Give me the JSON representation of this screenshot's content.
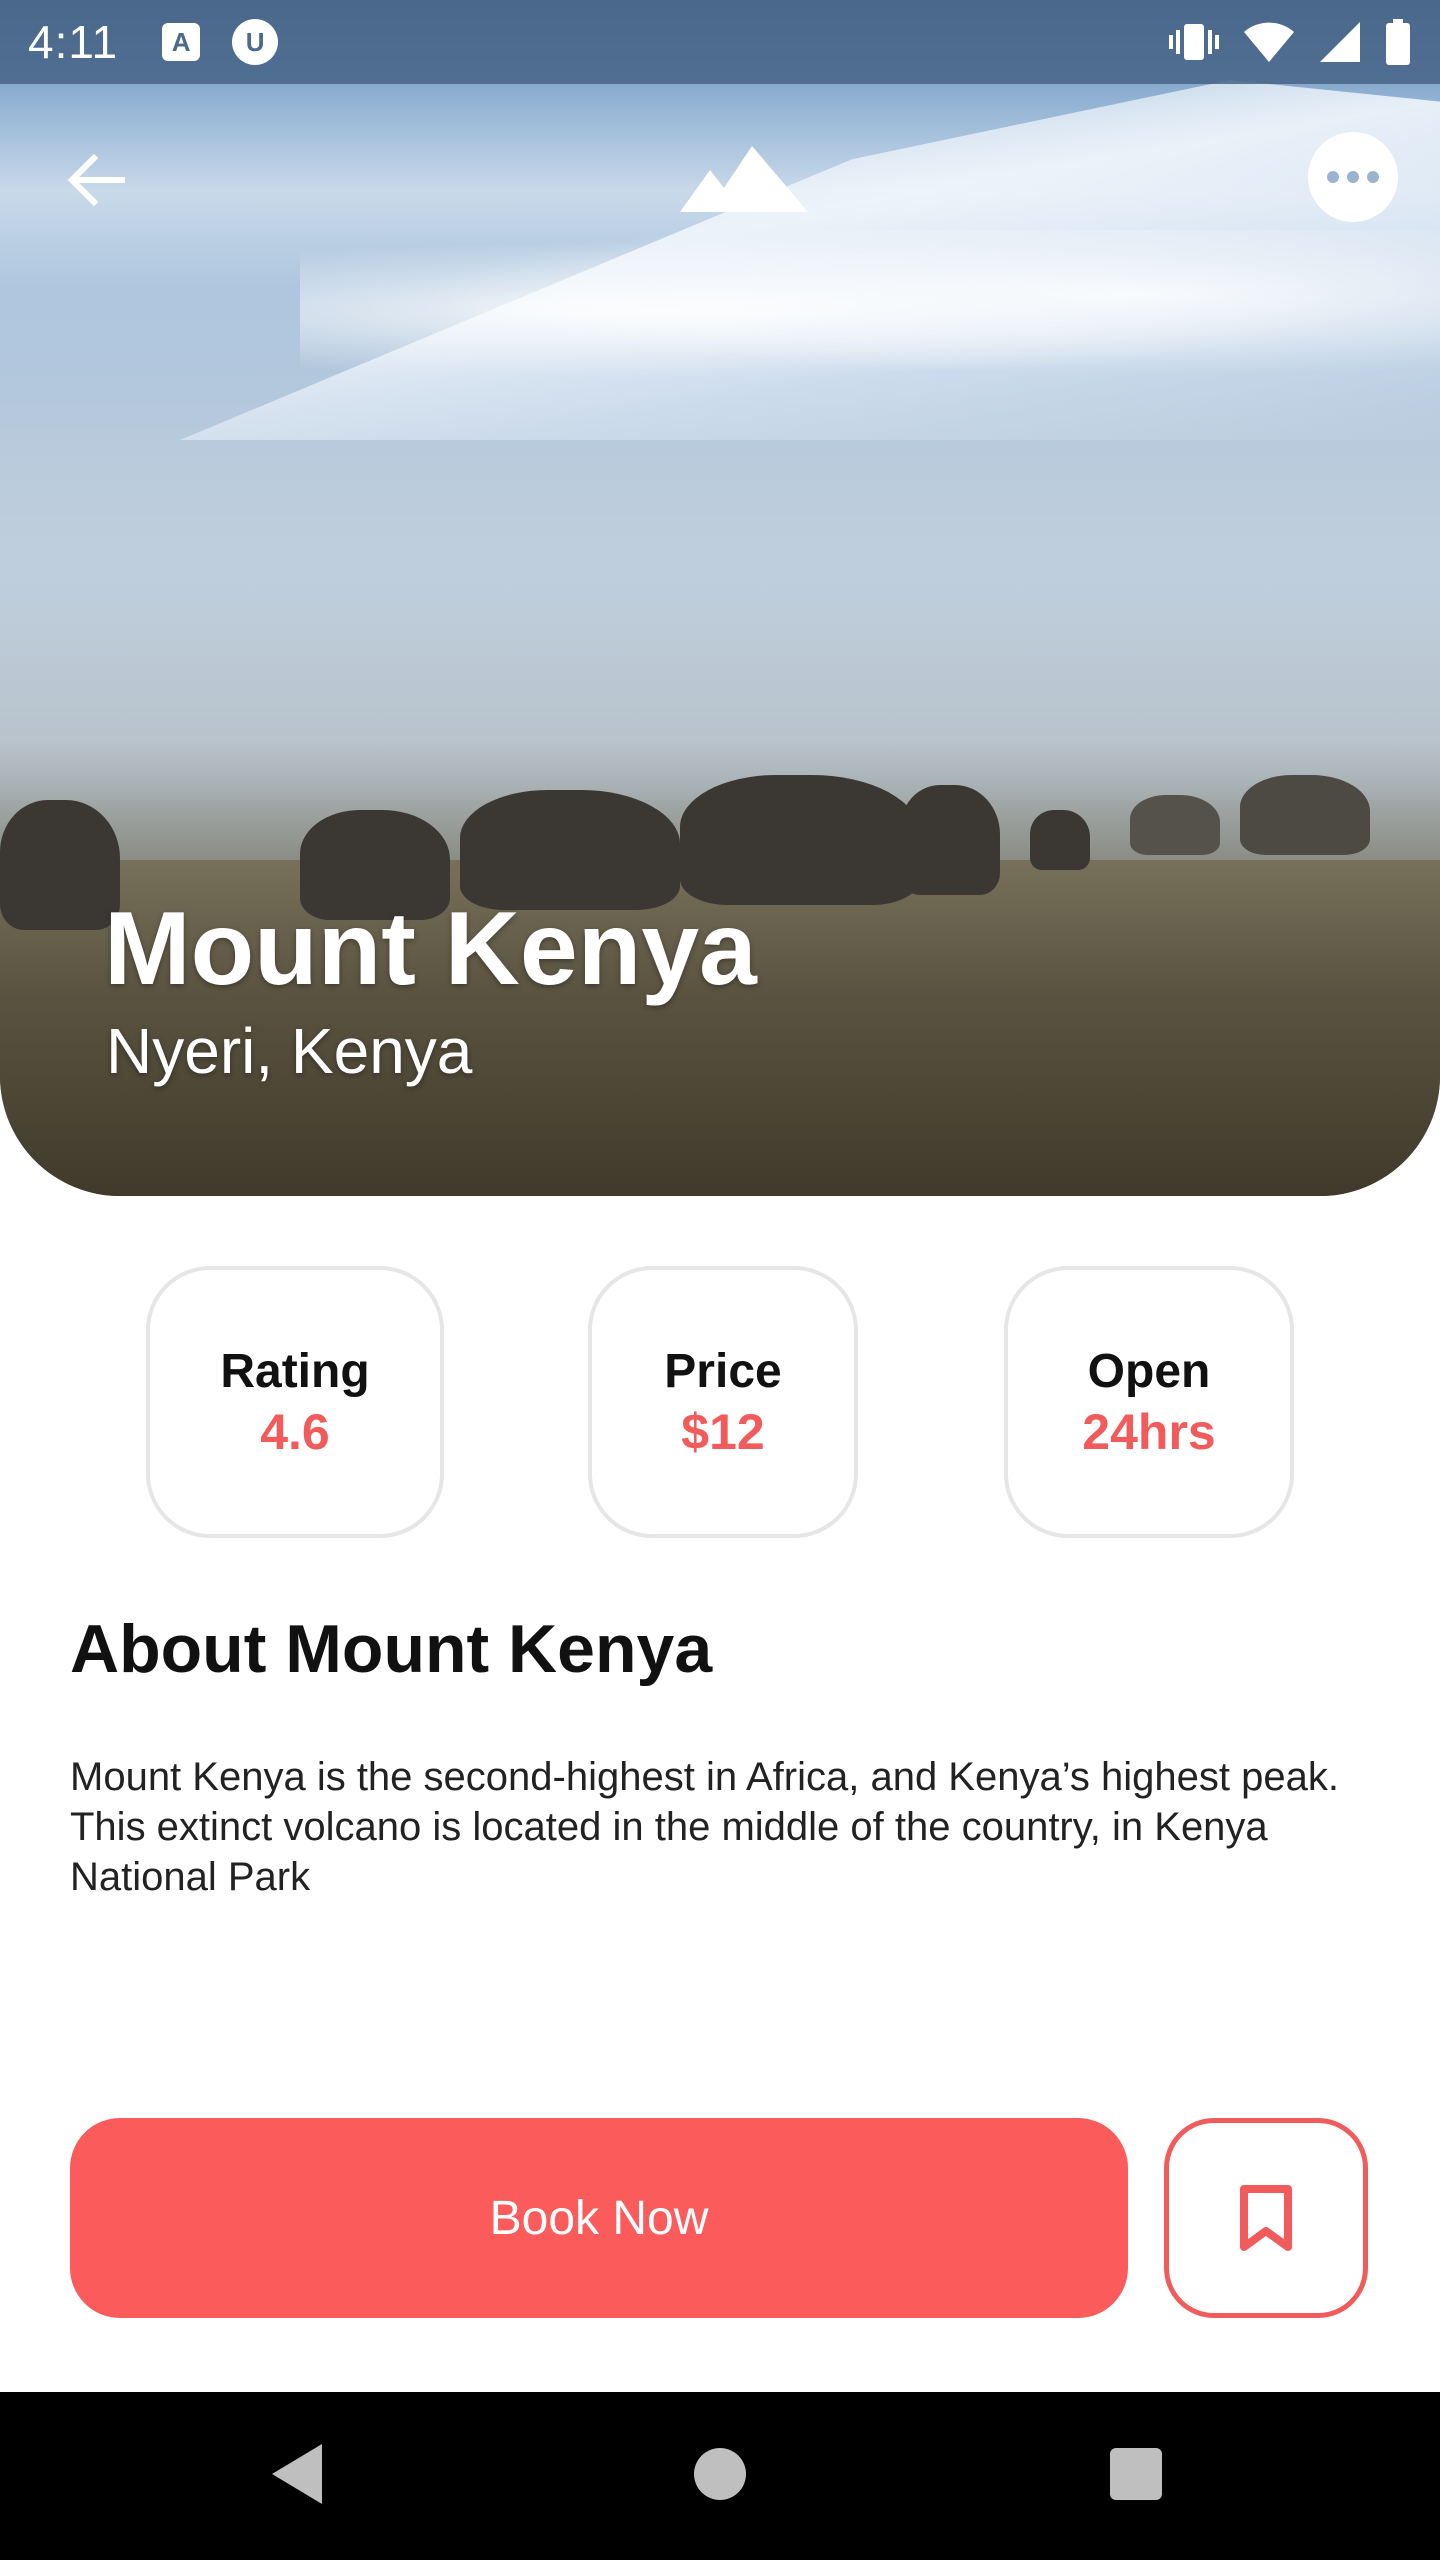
{
  "status_bar": {
    "time": "4:11",
    "app_icon_1": "A",
    "app_icon_2": "U"
  },
  "header": {
    "back_icon": "arrow-left-icon",
    "logo_icon": "mountain-logo-icon",
    "more_icon": "more-horizontal-icon"
  },
  "hero": {
    "title": "Mount Kenya",
    "subtitle": "Nyeri, Kenya"
  },
  "stats": [
    {
      "label": "Rating",
      "value": "4.6"
    },
    {
      "label": "Price",
      "value": "$12"
    },
    {
      "label": "Open",
      "value": "24hrs"
    }
  ],
  "about": {
    "title": "About Mount Kenya",
    "text": "Mount Kenya is the second-highest in Africa, and Kenya’s highest peak. This extinct volcano is located in the middle of the country, in Kenya National Park"
  },
  "actions": {
    "book_label": "Book Now",
    "bookmark_icon": "bookmark-icon"
  },
  "colors": {
    "accent": "#fb5b5b",
    "accent_text": "#f25b5b",
    "card_border": "#e6e6e6"
  }
}
